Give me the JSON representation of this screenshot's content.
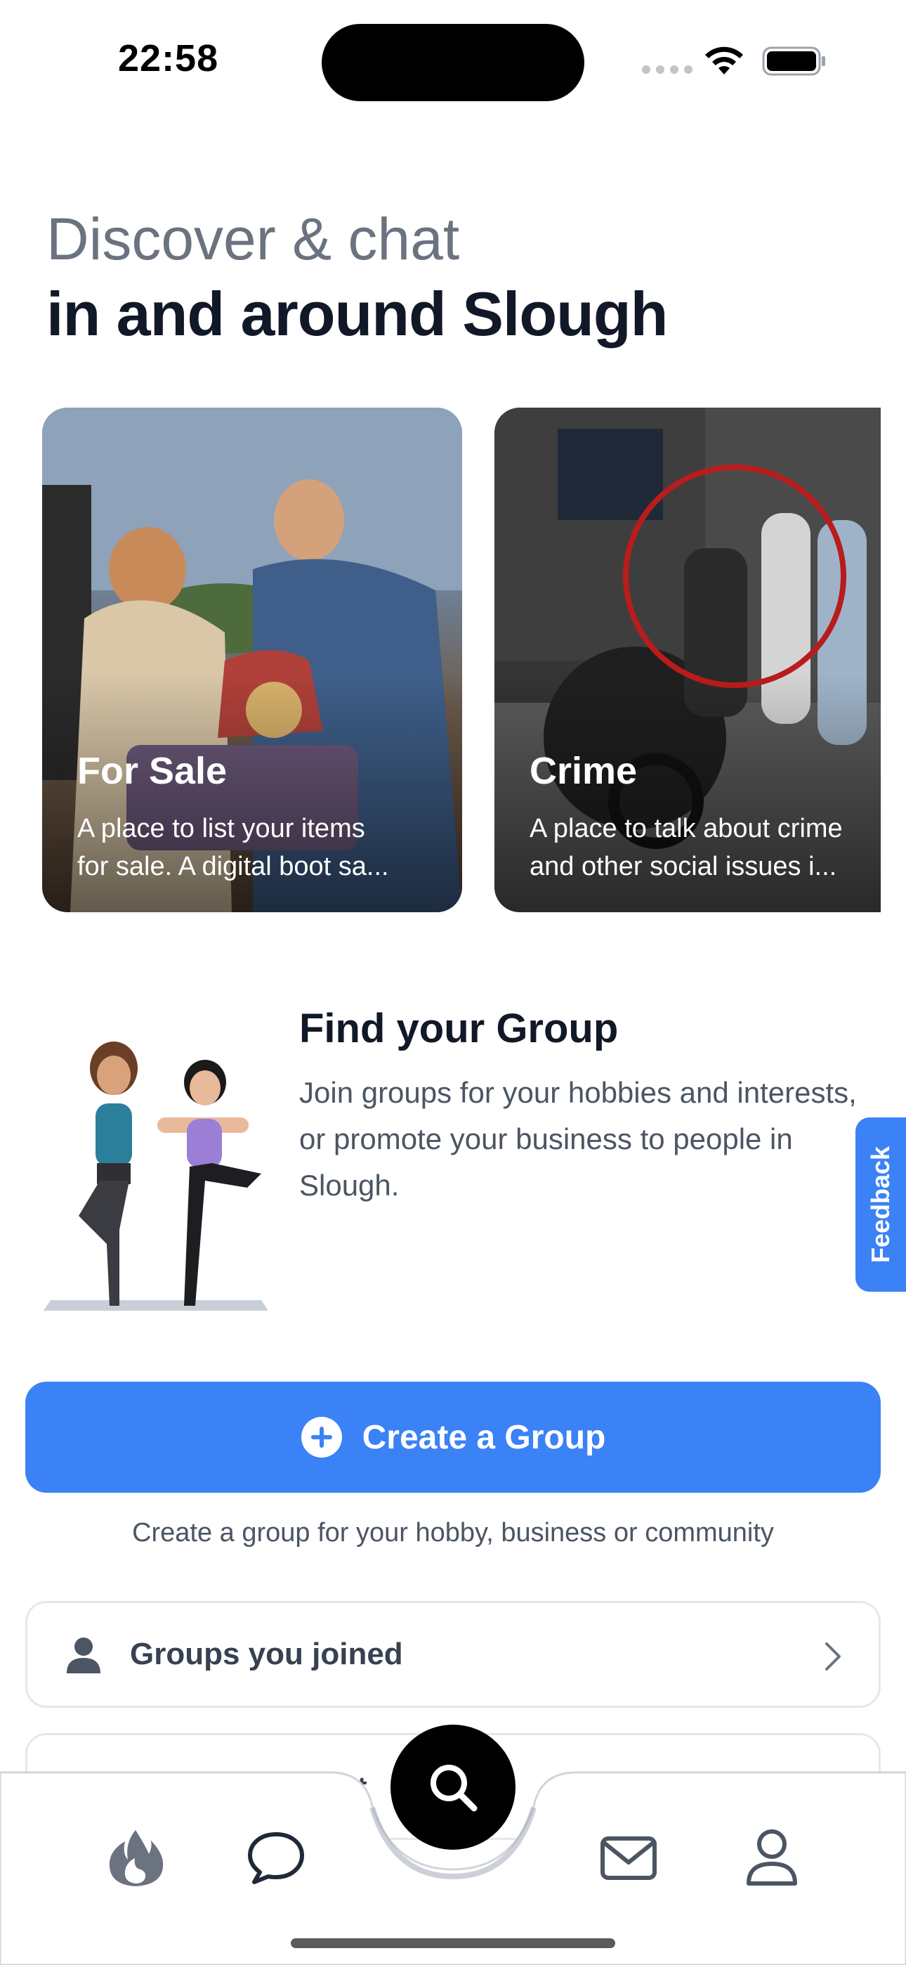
{
  "status_bar": {
    "time": "22:58",
    "icons": [
      "cellular-dots-icon",
      "wifi-icon",
      "battery-icon"
    ]
  },
  "heading": {
    "subtitle": "Discover & chat",
    "title": "in and around Slough"
  },
  "categories": [
    {
      "title": "For Sale",
      "description_line1": "A place to list your items",
      "description_line2": "for sale. A digital boot sa..."
    },
    {
      "title": "Crime",
      "description_line1": "A place to talk about crime",
      "description_line2": "and other social issues i..."
    }
  ],
  "find_group": {
    "title": "Find your Group",
    "description": "Join groups for your hobbies and interests, or promote your business to people in Slough."
  },
  "feedback": {
    "label": "Feedback"
  },
  "create_group": {
    "label": "Create a Group",
    "hint": "Create a group for your hobby, business or community"
  },
  "list": {
    "joined_label": "Groups you joined",
    "next_label_partial": "eat"
  },
  "bottom_nav": {
    "items": [
      "flame-icon",
      "chat-bubble-icon",
      "search-icon",
      "mail-icon",
      "profile-icon"
    ]
  },
  "colors": {
    "accent": "#3b82f6",
    "heading_muted": "#6b7280",
    "text_dark": "#111827"
  }
}
